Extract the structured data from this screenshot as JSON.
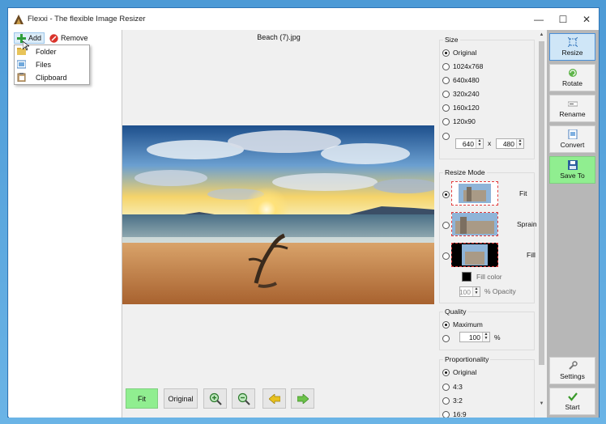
{
  "window": {
    "title": "Flexxi - The flexible Image Resizer",
    "controls": [
      "—",
      "☐",
      "✕"
    ]
  },
  "left_toolbar": {
    "add_label": "Add",
    "remove_label": "Remove"
  },
  "add_menu": {
    "items": [
      {
        "label": "Folder",
        "icon": "folder-icon"
      },
      {
        "label": "Files",
        "icon": "files-icon"
      },
      {
        "label": "Clipboard",
        "icon": "clipboard-icon"
      }
    ]
  },
  "preview": {
    "file_name": "Beach (7).jpg"
  },
  "bottom_toolbar": {
    "fit_label": "Fit",
    "original_label": "Original",
    "zoom_in_icon": "zoom-in-icon",
    "zoom_out_icon": "zoom-out-icon",
    "prev_icon": "arrow-left-icon",
    "next_icon": "arrow-right-icon"
  },
  "size_group": {
    "label": "Size",
    "options": [
      "Original",
      "1024x768",
      "640x480",
      "320x240",
      "160x120",
      "120x90"
    ],
    "selected": "Original",
    "custom_width": "640",
    "custom_height": "480",
    "times_sign": "x"
  },
  "resize_mode_group": {
    "label": "Resize Mode",
    "modes": [
      "Fit",
      "Sprain",
      "Fill"
    ],
    "selected": "Fit",
    "fill_color_label": "Fill color",
    "fill_color": "#000000",
    "opacity_value": "100",
    "opacity_label": "% Opacity"
  },
  "quality_group": {
    "label": "Quality",
    "maximum_label": "Maximum",
    "selected": "Maximum",
    "value": "100",
    "unit": "%"
  },
  "proportionality_group": {
    "label": "Proportionality",
    "options": [
      "Original",
      "4:3",
      "3:2",
      "16:9"
    ],
    "selected": "Original"
  },
  "actions": {
    "resize": "Resize",
    "rotate": "Rotate",
    "rename": "Rename",
    "convert": "Convert",
    "save_to": "Save To",
    "settings": "Settings",
    "start": "Start"
  },
  "colors": {
    "accent_green": "#90ee90",
    "selected_blue": "#cfe6f7",
    "thumb_border": "#e23d3d",
    "frame_blue": "#4c9ad6"
  }
}
